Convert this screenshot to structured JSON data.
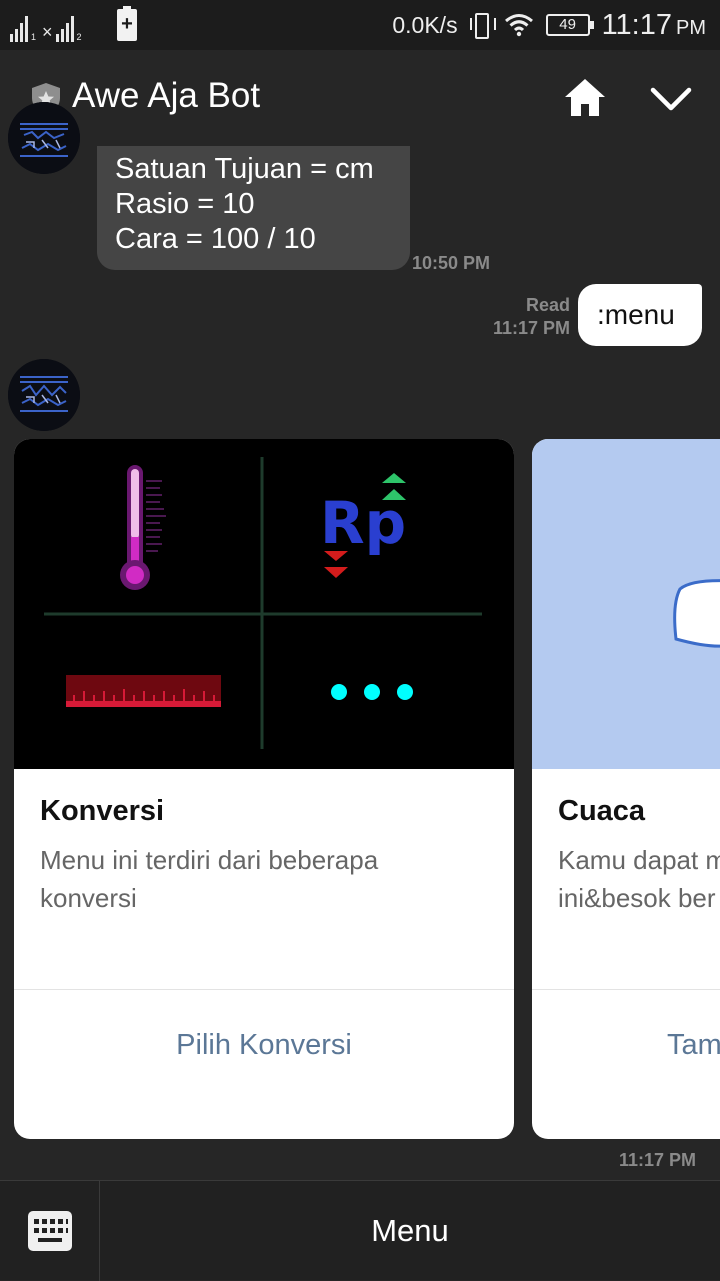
{
  "status_bar": {
    "sim1_index": "1",
    "sim2_index": "2",
    "sim2_mark": "×",
    "battery_plus": "+",
    "net_speed": "0.0K/s",
    "battery_level": "49",
    "time": "11:17",
    "ampm": "PM"
  },
  "header": {
    "title": "Awe Aja Bot",
    "icons": [
      "shield-icon",
      "home-icon",
      "chevron-down-icon"
    ]
  },
  "messages": {
    "bot_text": {
      "lines": [
        "Satuan Tujuan = cm",
        "Rasio = 10",
        "Cara = 100 / 10"
      ],
      "time": "10:50 PM"
    },
    "user": {
      "text": ":menu",
      "status": "Read",
      "time": "11:17 PM"
    },
    "carousel_time": "11:17 PM"
  },
  "carousel": [
    {
      "title": "Konversi",
      "desc_lines": [
        "Menu ini terdiri dari beberapa",
        "konversi"
      ],
      "action": "Pilih Konversi",
      "image_text": "Rp"
    },
    {
      "title": "Cuaca",
      "desc_lines": [
        "Kamu dapat m",
        "ini&besok ber"
      ],
      "action": "Tam"
    }
  ],
  "bottom": {
    "menu_label": "Menu",
    "keyboard_icon": "keyboard-icon"
  },
  "colors": {
    "background": "#262626",
    "status_bar": "#1c1c1c",
    "bubble_bot": "#454545",
    "bubble_user": "#ffffff",
    "link": "#5b7796",
    "card_bg": "#ffffff",
    "weather_bg": "#b4caf0"
  }
}
